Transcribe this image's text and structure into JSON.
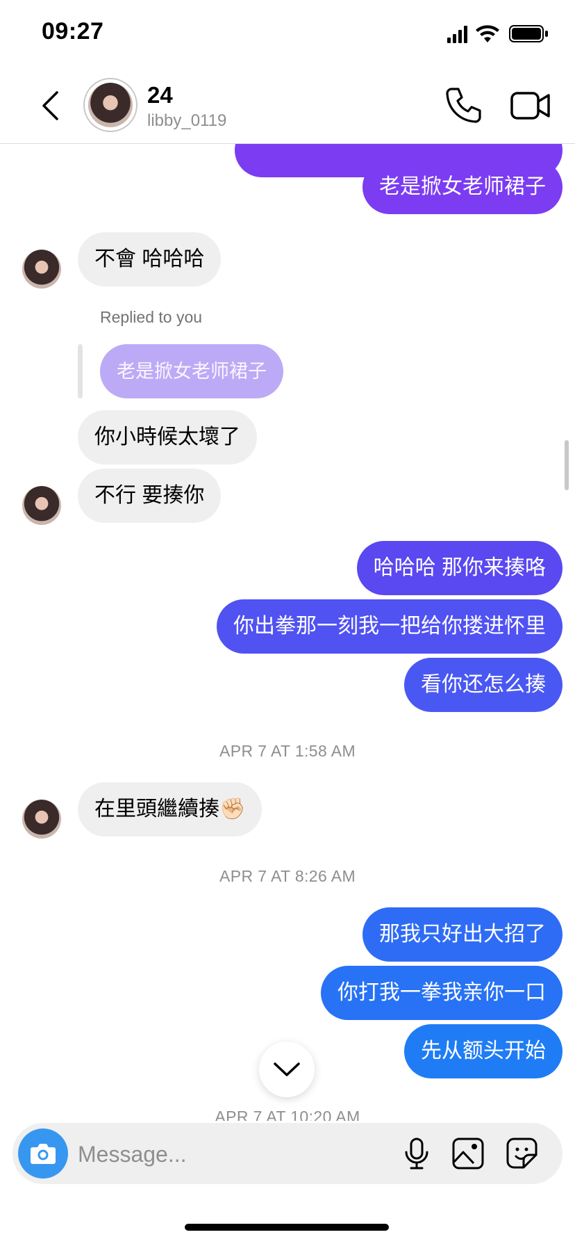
{
  "status_bar": {
    "time": "09:27",
    "icons": [
      "signal-icon",
      "wifi-icon",
      "battery-icon"
    ]
  },
  "header": {
    "title": "24",
    "username": "libby_0119",
    "icons": [
      "back-chevron-icon",
      "phone-icon",
      "video-camera-icon"
    ]
  },
  "messages": {
    "out_1": "老是掀女老师裙子",
    "in_1": "不會 哈哈哈",
    "reply_label": "Replied to you",
    "reply_quote": "老是掀女老师裙子",
    "in_2": "你小時候太壞了",
    "in_3": "不行 要揍你",
    "out_2": "哈哈哈 那你来揍咯",
    "out_3": "你出拳那一刻我一把给你搂进怀里",
    "out_4": "看你还怎么揍",
    "ts_1": "APR 7 AT 1:58 AM",
    "in_4": "在里頭繼續揍✊🏻",
    "ts_2": "APR 7 AT 8:26 AM",
    "out_5": "那我只好出大招了",
    "out_6": "你打我一拳我亲你一口",
    "out_7": "先从额头开始",
    "ts_3": "APR 7 AT 10:20 AM"
  },
  "composer": {
    "placeholder": "Message...",
    "icons": [
      "camera-icon",
      "microphone-icon",
      "gallery-icon",
      "sticker-icon"
    ]
  },
  "colors": {
    "outgoing_gradient": [
      "#7b3cf2",
      "#5a48f0",
      "#2f6cf6",
      "#1f7cf5"
    ],
    "incoming": "#efefef",
    "camera_button": "#3797f0"
  }
}
